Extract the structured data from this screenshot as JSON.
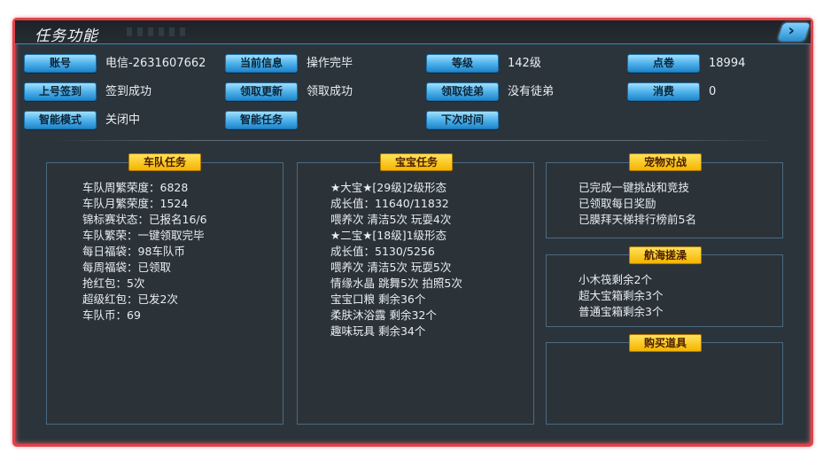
{
  "window": {
    "title": "任务功能",
    "close_icon": "chevron-right-icon"
  },
  "rows": [
    [
      {
        "label": "账号",
        "value": "电信-2631607662"
      },
      {
        "label": "当前信息",
        "value": "操作完毕"
      },
      {
        "label": "等级",
        "value": "142级"
      },
      {
        "label": "点卷",
        "value": "18994"
      }
    ],
    [
      {
        "label": "上号签到",
        "value": "签到成功"
      },
      {
        "label": "领取更新",
        "value": "领取成功"
      },
      {
        "label": "领取徒弟",
        "value": "没有徒弟"
      },
      {
        "label": "消费",
        "value": "0"
      }
    ],
    [
      {
        "label": "智能模式",
        "value": "关闭中"
      },
      {
        "label": "智能任务",
        "value": ""
      },
      {
        "label": "下次时间",
        "value": ""
      }
    ]
  ],
  "panels": {
    "team": {
      "title": "车队任务",
      "lines": [
        "车队周繁荣度：6828",
        "车队月繁荣度：1524",
        "锦标赛状态：已报名16/6",
        "车队繁荣：一键领取完毕",
        "每日福袋：98车队币",
        "每周福袋：已领取",
        "抢红包：5次",
        "超级红包：已发2次",
        "车队币：69"
      ]
    },
    "baby": {
      "title": "宝宝任务",
      "lines": [
        "★大宝★[29级]2级形态",
        "成长值：11640/11832",
        "喂养次 清洁5次 玩耍4次",
        "★二宝★[18级]1级形态",
        "成长值：5130/5256",
        "喂养次 清洁5次 玩耍5次",
        "情缘水晶 跳舞5次 拍照5次",
        "宝宝口粮  剩余36个",
        "柔肤沐浴露 剩余32个",
        "趣味玩具  剩余34个"
      ]
    },
    "pet": {
      "title": "宠物对战",
      "lines": [
        "已完成一键挑战和竞技",
        "已领取每日奖励",
        "已膜拜天梯排行榜前5名"
      ]
    },
    "voyage": {
      "title": "航海搓澡",
      "lines": [
        "小木筏剩余2个",
        "超大宝箱剩余3个",
        "普通宝箱剩余3个"
      ]
    },
    "shop": {
      "title": "购买道具",
      "lines": []
    }
  },
  "colors": {
    "frame_border": "#e0434c",
    "button": "#4fb2ea",
    "panel_title": "#f5b400",
    "background": "#2c343b"
  }
}
